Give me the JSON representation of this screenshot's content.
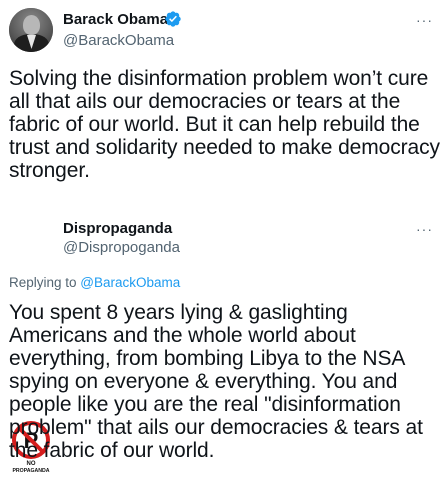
{
  "tweet1": {
    "name": "Barack Obama",
    "handle": "@BarackObama",
    "more": "···",
    "text": "Solving the disinformation problem won’t cure all that ails our democracies or tears at the fabric of our world. But it can help rebuild the trust and solidarity needed to make democracy stronger."
  },
  "tweet2": {
    "name": "Dispropaganda",
    "handle": "@Dispropoganda",
    "more": "···",
    "avatar_caption_top": "NO",
    "avatar_caption_bottom": "PROPAGANDA",
    "replying_prefix": "Replying to ",
    "replying_to": "@BarackObama",
    "text": "You spent 8 years lying & gaslighting Americans and the whole world about everything, from bombing Libya to the NSA spying on everyone & everything. You and people like you are the real \"disinformation problem\" that ails our democracies & tears at the fabric of our world."
  },
  "colors": {
    "text": "#0f1419",
    "secondary": "#536471",
    "link": "#1d9bf0",
    "verified": "#1d9bf0",
    "no_sign": "#d51e1e"
  },
  "icons": {
    "verified": "verified-badge-icon",
    "more": "more-options-icon",
    "no_sign": "no-propaganda-logo"
  }
}
